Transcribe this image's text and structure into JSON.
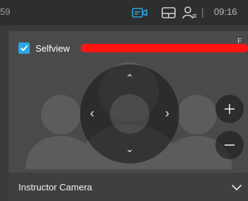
{
  "topbar": {
    "left_text": "59",
    "time": "09:16",
    "separator": "|",
    "icons": [
      "camera-share-icon",
      "layout-icon",
      "participants-icon"
    ],
    "accent": "#2aa7df"
  },
  "selfview": {
    "label": "Selfview",
    "checked": true,
    "redaction_color": "#ff1414",
    "redaction_tail": "F"
  },
  "camera_control": {
    "arrows": {
      "up": "⌃",
      "down": "⌄",
      "left": "‹",
      "right": "›"
    },
    "zoom_in": "+",
    "zoom_out": "−"
  },
  "camera_select": {
    "label": "Instructor Camera"
  }
}
